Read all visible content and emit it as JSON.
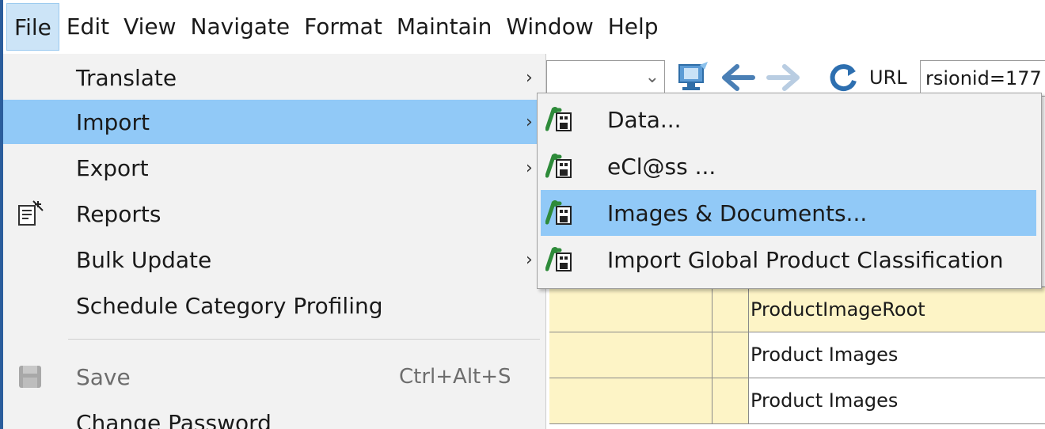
{
  "menubar": {
    "items": [
      "File",
      "Edit",
      "View",
      "Navigate",
      "Format",
      "Maintain",
      "Window",
      "Help"
    ]
  },
  "toolbar": {
    "url_label": "URL",
    "url_value": "rsionid=177"
  },
  "file_menu": {
    "items": [
      {
        "label": "Translate",
        "has_submenu": true
      },
      {
        "label": "Import",
        "has_submenu": true,
        "selected": true
      },
      {
        "label": "Export",
        "has_submenu": true
      },
      {
        "label": "Reports",
        "icon": "reports-icon"
      },
      {
        "label": "Bulk Update",
        "has_submenu": true
      },
      {
        "label": "Schedule Category Profiling"
      },
      {
        "label": "Save",
        "shortcut": "Ctrl+Alt+S",
        "disabled": true,
        "icon": "save-icon"
      },
      {
        "label": "Change Password"
      }
    ]
  },
  "import_submenu": {
    "items": [
      {
        "label": "Data...",
        "icon": "import-icon"
      },
      {
        "label": "eCl@ss ...",
        "icon": "import-icon"
      },
      {
        "label": "Images & Documents...",
        "icon": "import-icon",
        "selected": true
      },
      {
        "label": "Import Global Product Classification",
        "icon": "import-icon"
      }
    ]
  },
  "grid": {
    "rows": [
      "ProductImageRoot",
      "Product Images",
      "Product Images"
    ]
  },
  "colors": {
    "selection": "#91c9f7",
    "menu_bg": "#f2f2f2",
    "cell_yellow": "#fdf4c6",
    "frame_blue": "#2b5d9c"
  }
}
